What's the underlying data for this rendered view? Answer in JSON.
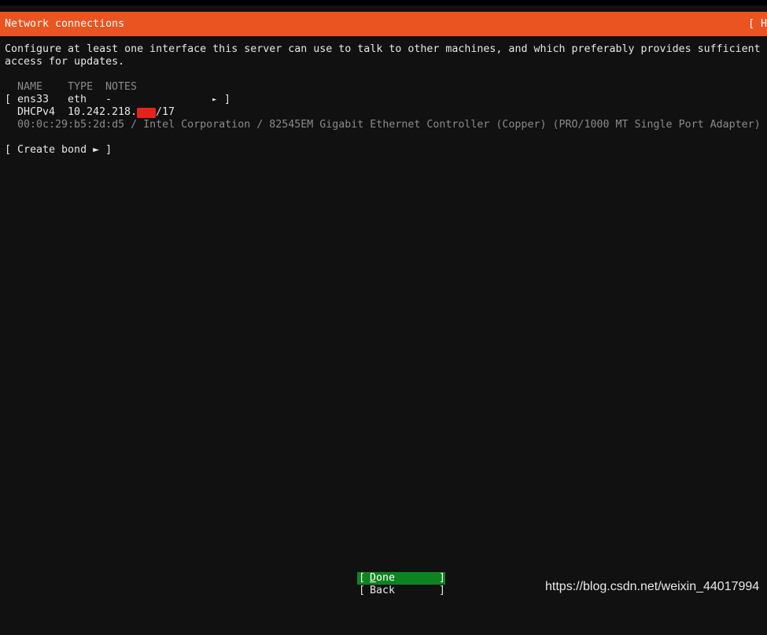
{
  "header": {
    "title": "Network connections",
    "help": "[ H"
  },
  "description": {
    "line1": "Configure at least one interface this server can use to talk to other machines, and which preferably provides sufficient",
    "line2": "access for updates."
  },
  "table": {
    "columns": [
      "NAME",
      "TYPE",
      "NOTES"
    ],
    "interfaces": [
      {
        "bracket_open": "[",
        "name": "ens33",
        "type": "eth",
        "notes": "-",
        "arrow": "►",
        "bracket_close": "]",
        "addr_method": "DHCPv4",
        "addr_prefix": "10.242.218.",
        "addr_suffix": "/17",
        "hw_info": "00:0c:29:b5:2d:d5 / Intel Corporation / 82545EM Gigabit Ethernet Controller (Copper) (PRO/1000 MT Single Port Adapter)"
      }
    ]
  },
  "create_bond": "[ Create bond ► ]",
  "buttons": {
    "done_first": "D",
    "done_rest": "one",
    "back": "Back",
    "open": "[",
    "close": "]"
  },
  "watermark": "https://blog.csdn.net/weixin_44017994",
  "colors": {
    "header_bg": "#e95420",
    "focus_bg": "#0e8420",
    "redaction": "#e5231c"
  }
}
